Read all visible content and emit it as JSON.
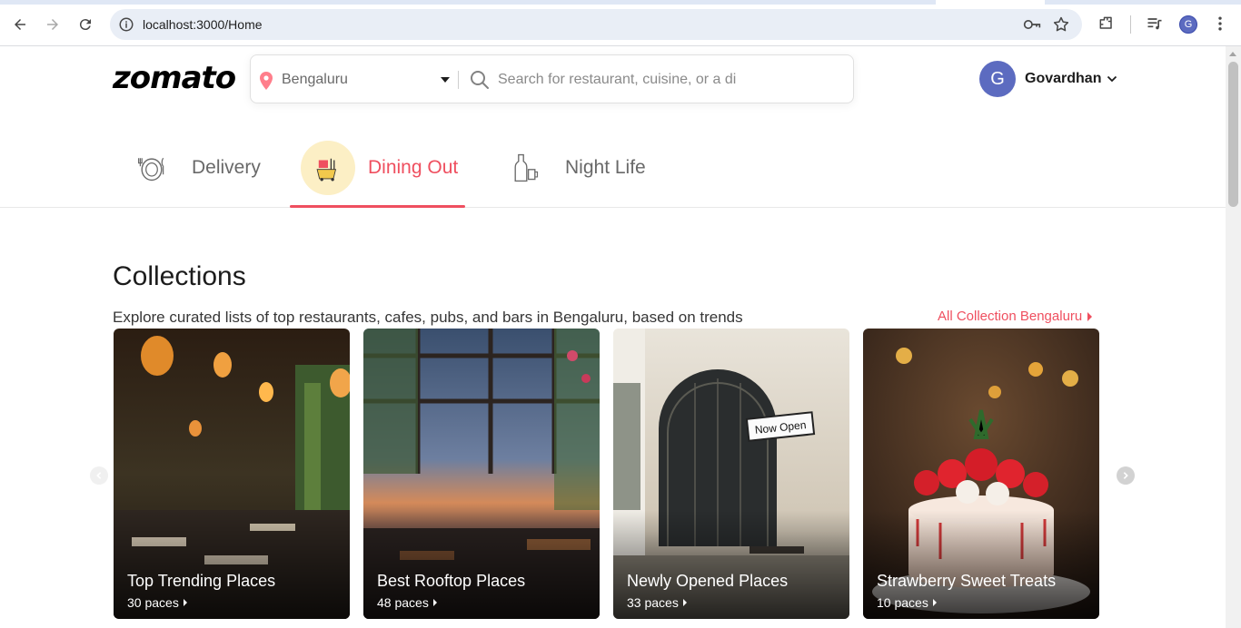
{
  "browser": {
    "url": "localhost:3000/Home",
    "profile_initial": "G"
  },
  "header": {
    "logo": "zomato",
    "location": "Bengaluru",
    "search_placeholder": "Search for restaurant, cuisine, or a di",
    "user_initial": "G",
    "user_name": "Govardhan"
  },
  "tabs": [
    {
      "label": "Delivery",
      "icon": "delivery-icon",
      "active": false
    },
    {
      "label": "Dining Out",
      "icon": "dining-out-icon",
      "active": true
    },
    {
      "label": "Night Life",
      "icon": "night-life-icon",
      "active": false
    }
  ],
  "collections": {
    "title": "Collections",
    "subtitle": "Explore curated lists of top restaurants, cafes, pubs, and bars in Bengaluru, based on trends",
    "all_link": "All Collection Bengaluru",
    "cards": [
      {
        "title": "Top Trending Places",
        "count": "30 paces"
      },
      {
        "title": "Best Rooftop Places",
        "count": "48 paces"
      },
      {
        "title": "Newly Opened Places",
        "count": "33 paces"
      },
      {
        "title": "Strawberry Sweet Treats",
        "count": "10 paces"
      }
    ],
    "sign_text": "Now Open"
  },
  "colors": {
    "brand_red": "#ef4f5f",
    "avatar": "#5c6bc0",
    "active_tab_bg": "#fcefc5"
  }
}
